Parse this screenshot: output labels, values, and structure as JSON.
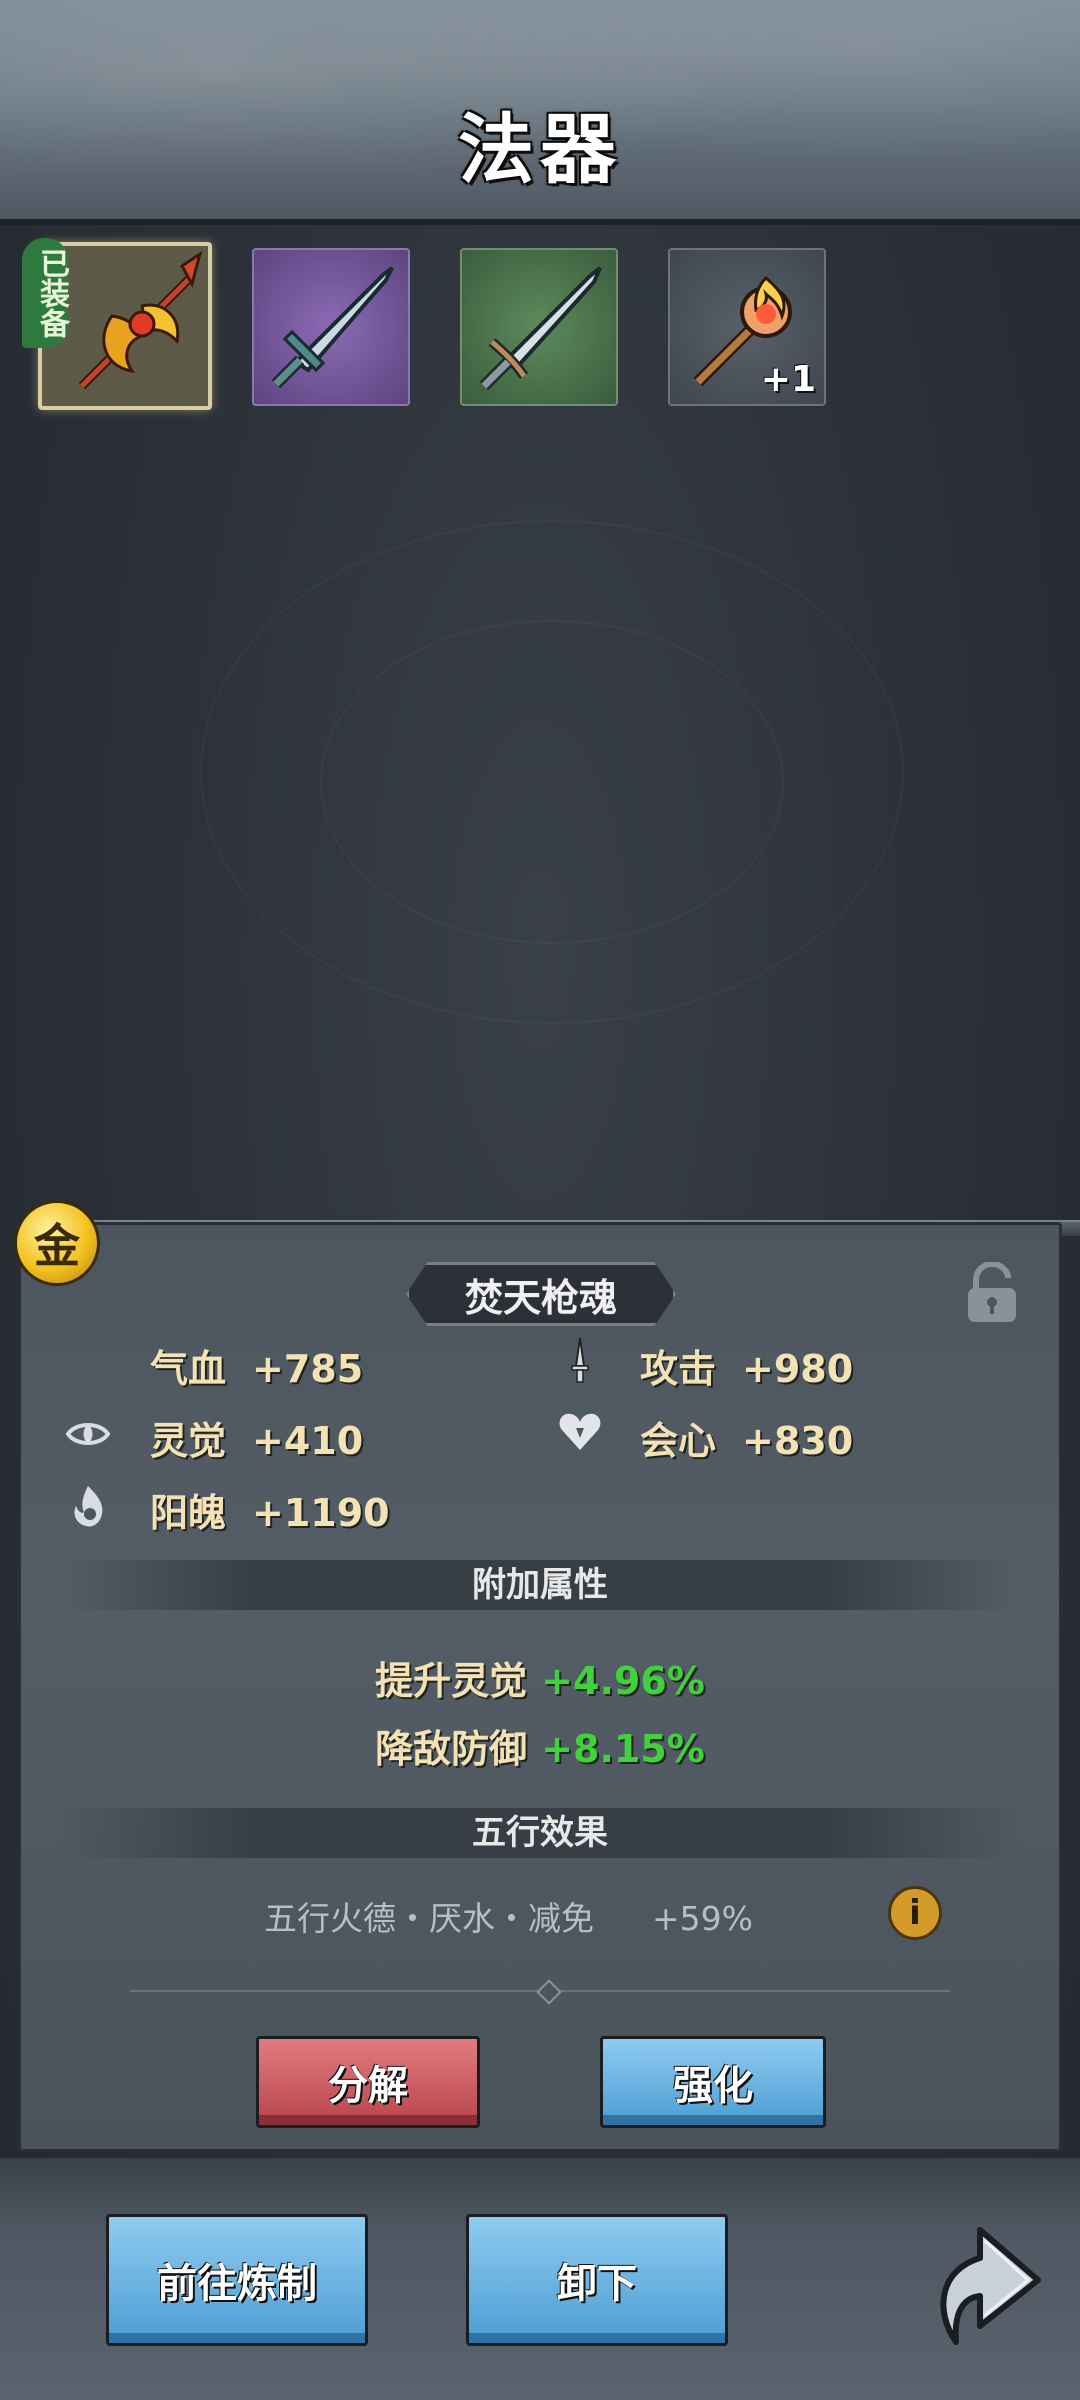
{
  "header": {
    "title": "法器"
  },
  "inventory": {
    "slots": [
      {
        "name": "fire-spear-slot",
        "equipped": true,
        "equipped_label": "已装备"
      },
      {
        "name": "purple-sword-slot"
      },
      {
        "name": "green-sword-slot"
      },
      {
        "name": "torch-slot",
        "badge": "+1"
      }
    ]
  },
  "detail": {
    "element_badge": "金",
    "item_name": "焚天枪魂",
    "stats": [
      {
        "label": "气血",
        "value": "+785"
      },
      {
        "label": "攻击",
        "value": "+980"
      },
      {
        "label": "灵觉",
        "value": "+410"
      },
      {
        "label": "会心",
        "value": "+830"
      },
      {
        "label": "阳魄",
        "value": "+1190"
      }
    ],
    "extra_title": "附加属性",
    "extra": [
      {
        "label": "提升灵觉",
        "value": "+4.96%"
      },
      {
        "label": "降敌防御",
        "value": "+8.15%"
      }
    ],
    "five_title": "五行效果",
    "five_effect": {
      "text": "五行火德・厌水・减免",
      "value": "+59%"
    },
    "info_symbol": "i",
    "buttons": {
      "decompose": "分解",
      "enhance": "强化"
    }
  },
  "bottom": {
    "goto_refine": "前往炼制",
    "unequip": "卸下"
  },
  "colors": {
    "stat_text": "#f3e3b4",
    "bonus_value": "#3fd23a",
    "red_button": "#c85a5f",
    "blue_button": "#66b3e2"
  }
}
